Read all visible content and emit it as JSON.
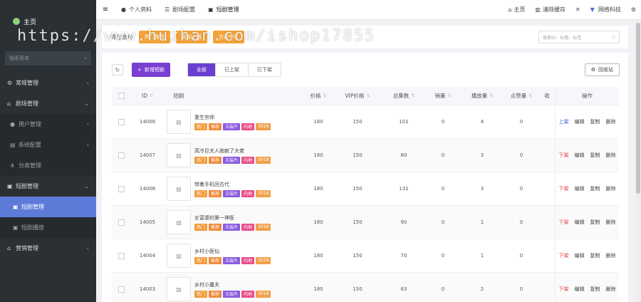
{
  "sidebar": {
    "brand": "主页",
    "search_placeholder": "搜索菜单",
    "items": [
      {
        "label": "常规管理",
        "icon": "gears-icon"
      },
      {
        "label": "剧场管理",
        "icon": "home-icon"
      },
      {
        "label": "用户管理",
        "icon": "user-icon"
      },
      {
        "label": "系统配置",
        "icon": "file-icon"
      },
      {
        "label": "分类管理",
        "icon": "sitemap-icon"
      },
      {
        "label": "短剧管理",
        "icon": "briefcase-icon"
      },
      {
        "label": "短剧管理",
        "icon": "briefcase-icon"
      },
      {
        "label": "短剧播放",
        "icon": "briefcase-icon"
      },
      {
        "label": "营销管理",
        "icon": "home-icon"
      }
    ]
  },
  "topbar": {
    "tabs": [
      {
        "label": "个人资料",
        "icon": "user-icon"
      },
      {
        "label": "剧场配置",
        "icon": "sliders-icon"
      },
      {
        "label": "短剧管理",
        "icon": "briefcase-icon"
      }
    ],
    "home": "主页",
    "clear_cache": "清除缓存",
    "company": "网络科技"
  },
  "filter": {
    "label": "筛选条件",
    "buttons": [
      "热门推荐",
      "新剧上线",
      "古装专区"
    ],
    "search_placeholder": "搜索ID、标题、标签"
  },
  "toolbar": {
    "add_label": "新增短剧",
    "segments": [
      "全部",
      "已上架",
      "已下架"
    ],
    "recycle_label": "回收站"
  },
  "table": {
    "headers": {
      "id": "ID",
      "image": "短剧",
      "price": "价格",
      "vip": "VIP价格",
      "episodes": "总集数",
      "sales": "销量",
      "plays": "播放量",
      "likes": "点赞量",
      "fav": "收",
      "ops": "操作"
    },
    "ops": {
      "edit": "编辑",
      "copy": "复制",
      "delete": "删除"
    },
    "rows": [
      {
        "id": "14008",
        "title": "重生宗师",
        "tags": [
          "热门",
          "推荐",
          "古装片",
          "内地",
          "2018"
        ],
        "price": "180",
        "vip": "150",
        "episodes": "101",
        "sales": "0",
        "plays": "4",
        "likes": "0",
        "status": "上架"
      },
      {
        "id": "14007",
        "title": "高冷巨夫人她疯了大佬",
        "tags": [
          "热门",
          "推荐",
          "古装片",
          "内地",
          "2018"
        ],
        "price": "180",
        "vip": "150",
        "episodes": "80",
        "sales": "0",
        "plays": "3",
        "likes": "0",
        "status": "下架"
      },
      {
        "id": "14006",
        "title": "带着手机回古代",
        "tags": [
          "热门",
          "推荐",
          "古装片",
          "内地",
          "2018"
        ],
        "price": "180",
        "vip": "150",
        "episodes": "131",
        "sales": "0",
        "plays": "3",
        "likes": "0",
        "status": "下架"
      },
      {
        "id": "14005",
        "title": "女富婆的第一神医",
        "tags": [
          "热门",
          "推荐",
          "古装片",
          "内地",
          "2018"
        ],
        "price": "180",
        "vip": "150",
        "episodes": "90",
        "sales": "0",
        "plays": "1",
        "likes": "0",
        "status": "下架"
      },
      {
        "id": "14004",
        "title": "乡村小医仙",
        "tags": [
          "热门",
          "推荐",
          "古装片",
          "内地",
          "2018"
        ],
        "price": "180",
        "vip": "150",
        "episodes": "70",
        "sales": "0",
        "plays": "1",
        "likes": "0",
        "status": "下架"
      },
      {
        "id": "14003",
        "title": "乡村小屠夫",
        "tags": [
          "热门",
          "推荐",
          "古装片",
          "内地",
          "2018"
        ],
        "price": "180",
        "vip": "150",
        "episodes": "83",
        "sales": "0",
        "plays": "2",
        "likes": "0",
        "status": "下架"
      }
    ]
  },
  "watermark": "https://www.huzhan.com/ishop17855",
  "colors": {
    "sidebar": "#2b3035",
    "active": "#5c7bd9",
    "accent": "#7a3fd2",
    "orange": "#f4a338"
  }
}
